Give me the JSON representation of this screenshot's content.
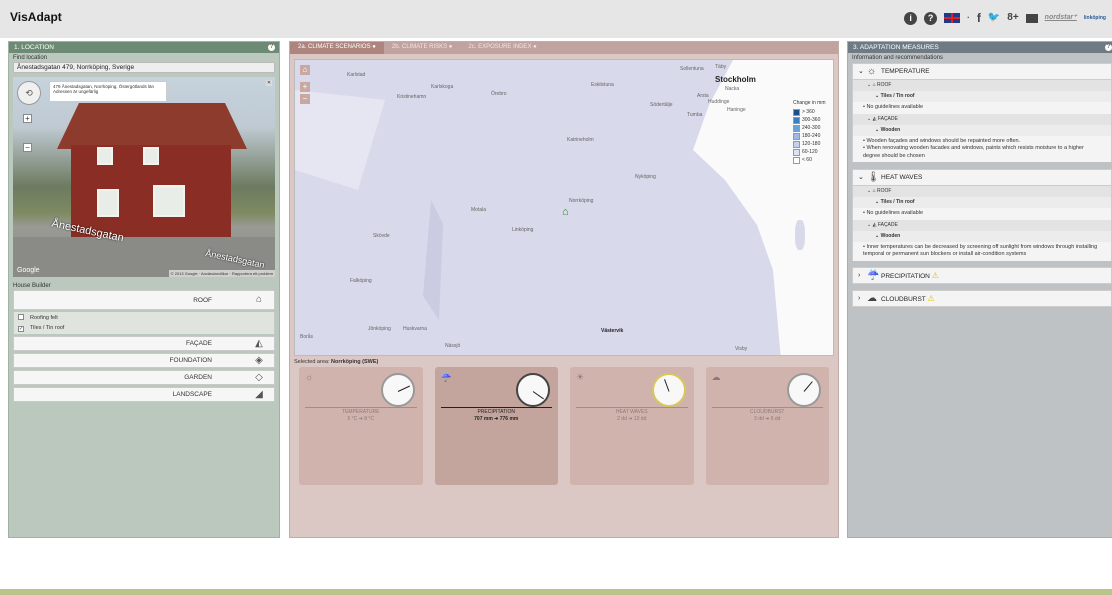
{
  "app": {
    "title": "VisAdapt"
  },
  "topbar": {
    "info_icon": "i",
    "help_icon": "?",
    "share_sep": "·",
    "facebook": "f",
    "twitter": "🐦",
    "gplus": "8+",
    "logo_nordstar": "nordstar⁺",
    "logo_partner": "linköping"
  },
  "left": {
    "title": "1. LOCATION",
    "find_label": "Find location",
    "address_value": "Ånestadsgatan 479, Norrköping, Sverige",
    "streetview": {
      "info_line1": "479 Ånestadsgatan, Norrköping, Östergötlands län",
      "info_line2": "Adressen är ungefärlig",
      "street_label": "Ånestadsgatan",
      "street_label2": "Ånestadsgatan",
      "google": "Google",
      "footer": "© 2013 Google · Användarvillkor · Rapportera ett problem"
    },
    "house_builder_label": "House Builder",
    "roof_label": "ROOF",
    "roof_options": [
      {
        "label": "Roofing felt",
        "checked": false
      },
      {
        "label": "Tiles / Tin roof",
        "checked": true
      }
    ],
    "facade_label": "FAÇADE",
    "foundation_label": "FOUNDATION",
    "garden_label": "GARDEN",
    "landscape_label": "LANDSCAPE"
  },
  "middle": {
    "tabs": [
      "2a. CLIMATE SCENARIOS",
      "2b. CLIMATE RISKS",
      "2c. EXPOSURE INDEX"
    ],
    "map": {
      "cities": [
        "Karlstad",
        "Karlskoga",
        "Kristinehamn",
        "Örebro",
        "Eskilstuna",
        "Sollentuna",
        "Täby",
        "Stockholm",
        "Nacka",
        "Arsta",
        "Huddinge",
        "Södertälje",
        "Tumba",
        "Haninge",
        "Katrineholm",
        "Nyköping",
        "Norrköping",
        "Linköping",
        "Motala",
        "Skövde",
        "Falköping",
        "Jönköping",
        "Huskvarna",
        "Nässjö",
        "Västervik",
        "Borås",
        "Visby"
      ],
      "legend_title": "Change in mm",
      "legend": [
        {
          "label": "> 360",
          "color": "#1a4f8a"
        },
        {
          "label": "300-360",
          "color": "#3d7dbf"
        },
        {
          "label": "240-300",
          "color": "#6aa0d8"
        },
        {
          "label": "180-240",
          "color": "#9fb8e4"
        },
        {
          "label": "120-180",
          "color": "#c5d0ee"
        },
        {
          "label": "60-120",
          "color": "#dfe2f4"
        },
        {
          "label": "< 60",
          "color": "#ffffff"
        }
      ]
    },
    "selected_area_label": "Selected area:",
    "selected_area_value": "Norrköping (SWE)",
    "cards": [
      {
        "title": "TEMPERATURE",
        "value": "5 °C ➜ 8 °C",
        "selected": false
      },
      {
        "title": "PRECIPITATION",
        "value": "707 mm ➜ 776 mm",
        "selected": true
      },
      {
        "title": "HEAT WAVES",
        "value": "2 dd ➜ 13 dd",
        "selected": false
      },
      {
        "title": "CLOUDBURST",
        "value": "3 dd ➜ 6 dd",
        "selected": false
      }
    ]
  },
  "right": {
    "title": "3. ADAPTATION MEASURES",
    "intro": "Information and recommendations",
    "temperature": {
      "label": "TEMPERATURE",
      "roof_label": "ROOF",
      "roof_sub": "Tiles / Tin roof",
      "roof_text": "• No guidelines available",
      "facade_label": "FAÇADE",
      "facade_sub": "Wooden",
      "facade_text1": "• Wooden façades and windows should be repainted more often.",
      "facade_text2": "• When renovating wooden facades and windows, paints which resists moisture to a higher degree should be chosen"
    },
    "heatwaves": {
      "label": "HEAT WAVES",
      "roof_label": "ROOF",
      "roof_sub": "Tiles / Tin roof",
      "roof_text": "• No guidelines available",
      "facade_label": "FAÇADE",
      "facade_sub": "Wooden",
      "facade_text": "• Inner temperatures can be decreased by screening off sunlight from windows through installing temporal or permanent sun blockers or install air-condition systems"
    },
    "precipitation_label": "PRECIPITATION",
    "cloudburst_label": "CLOUDBURST"
  }
}
